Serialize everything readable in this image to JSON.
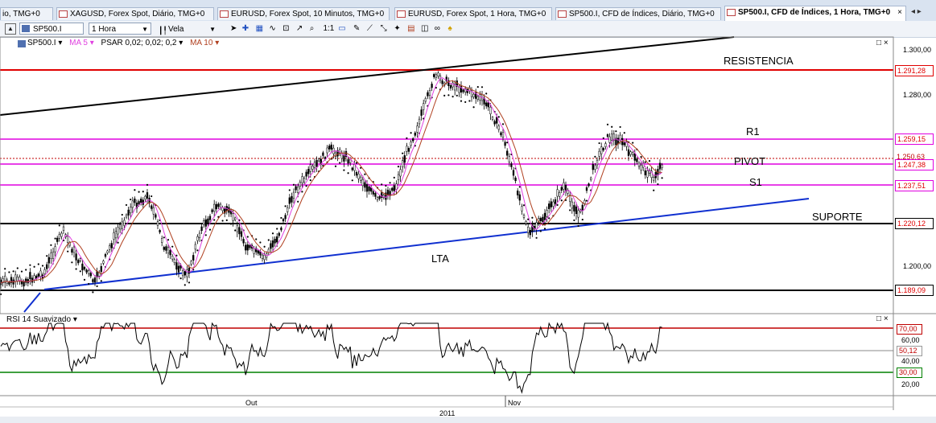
{
  "tabs": [
    {
      "label": "io, TMG+0",
      "active": false
    },
    {
      "label": "XAGUSD, Forex Spot, Diário, TMG+0",
      "active": false
    },
    {
      "label": "EURUSD, Forex Spot, 10 Minutos, TMG+0",
      "active": false
    },
    {
      "label": "EURUSD, Forex Spot, 1 Hora, TMG+0",
      "active": false
    },
    {
      "label": "SP500.I, CFD de Índices, Diário, TMG+0",
      "active": false
    },
    {
      "label": "SP500.I, CFD de Índices, 1 Hora, TMG+0",
      "active": true
    }
  ],
  "tab_close": "×",
  "tab_nav": "◂ ▸",
  "toolbar": {
    "symbol": "SP500.I",
    "timeframe": "1 Hora",
    "chart_type": "Vela",
    "collapse": "▲"
  },
  "indicators": {
    "symbol": "SP500.I ▾",
    "ma5": "MA 5 ▾",
    "psar": "PSAR 0,02; 0,02; 0,2 ▾",
    "ma10": "MA 10 ▾",
    "colors": {
      "ma5": "#e040e0",
      "psar": "#000000",
      "ma10": "#b04020"
    }
  },
  "rsi_label": "RSI 14 Suavizado ▾",
  "window_buttons": "□ ×",
  "annotations": {
    "resistencia": "RESISTENCIA",
    "r1": "R1",
    "pivot": "PIVOT",
    "s1": "S1",
    "suporte": "SUPORTE",
    "lta": "LTA"
  },
  "price_axis": [
    "1.300,00",
    "1.280,00",
    "1.200,00"
  ],
  "price_levels": {
    "resistencia": "1.291,28",
    "r1": "1.259,15",
    "current": "1.250,63",
    "pivot": "1.247,38",
    "s1": "1.237,51",
    "suporte": "1.220,12",
    "bottom": "1.189,09"
  },
  "rsi_axis": [
    "70,00",
    "60,00",
    "50,12",
    "40,00",
    "30,00",
    "20,00"
  ],
  "time_axis": {
    "months": [
      "Out",
      "Nov"
    ],
    "year": "2011"
  },
  "colors": {
    "resistance": "#e00000",
    "pivot_lines": "#e000e0",
    "support": "#000000",
    "trendline": "#1030d0",
    "rsi_upper": "#c00000",
    "rsi_lower": "#008000"
  }
}
